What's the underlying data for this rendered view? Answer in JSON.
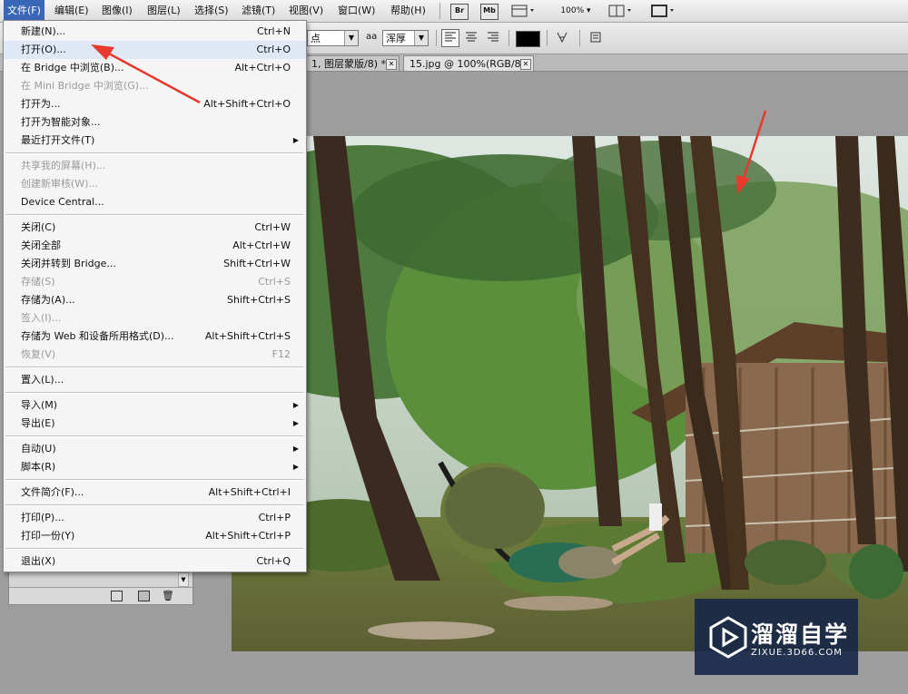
{
  "menubar": {
    "items": [
      "文件(F)",
      "编辑(E)",
      "图像(I)",
      "图层(L)",
      "选择(S)",
      "滤镜(T)",
      "视图(V)",
      "窗口(W)",
      "帮助(H)"
    ],
    "toolbar": {
      "br": "Br",
      "mb": "Mb",
      "zoom": "100%"
    }
  },
  "options": {
    "font_size": "点",
    "aa_icon": "aa",
    "aa_mode": "浑厚"
  },
  "tabs": [
    {
      "label": "1, 图层蒙版/8) *"
    },
    {
      "label": "15.jpg @ 100%(RGB/8)"
    }
  ],
  "file_menu": {
    "items": [
      {
        "label": "新建(N)...",
        "shortcut": "Ctrl+N"
      },
      {
        "label": "打开(O)...",
        "shortcut": "Ctrl+O",
        "highlight": true
      },
      {
        "label": "在 Bridge 中浏览(B)...",
        "shortcut": "Alt+Ctrl+O"
      },
      {
        "label": "在 Mini Bridge 中浏览(G)...",
        "shortcut": "",
        "disabled": true
      },
      {
        "label": "打开为...",
        "shortcut": "Alt+Shift+Ctrl+O"
      },
      {
        "label": "打开为智能对象...",
        "shortcut": ""
      },
      {
        "label": "最近打开文件(T)",
        "shortcut": "",
        "submenu": true
      },
      {
        "sep": true
      },
      {
        "label": "共享我的屏幕(H)...",
        "shortcut": "",
        "disabled": true
      },
      {
        "label": "创建新审核(W)...",
        "shortcut": "",
        "disabled": true
      },
      {
        "label": "Device Central...",
        "shortcut": ""
      },
      {
        "sep": true
      },
      {
        "label": "关闭(C)",
        "shortcut": "Ctrl+W"
      },
      {
        "label": "关闭全部",
        "shortcut": "Alt+Ctrl+W"
      },
      {
        "label": "关闭并转到 Bridge...",
        "shortcut": "Shift+Ctrl+W"
      },
      {
        "label": "存储(S)",
        "shortcut": "Ctrl+S",
        "disabled": true
      },
      {
        "label": "存储为(A)...",
        "shortcut": "Shift+Ctrl+S"
      },
      {
        "label": "签入(I)...",
        "shortcut": "",
        "disabled": true
      },
      {
        "label": "存储为 Web 和设备所用格式(D)...",
        "shortcut": "Alt+Shift+Ctrl+S"
      },
      {
        "label": "恢复(V)",
        "shortcut": "F12",
        "disabled": true
      },
      {
        "sep": true
      },
      {
        "label": "置入(L)...",
        "shortcut": ""
      },
      {
        "sep": true
      },
      {
        "label": "导入(M)",
        "shortcut": "",
        "submenu": true
      },
      {
        "label": "导出(E)",
        "shortcut": "",
        "submenu": true
      },
      {
        "sep": true
      },
      {
        "label": "自动(U)",
        "shortcut": "",
        "submenu": true
      },
      {
        "label": "脚本(R)",
        "shortcut": "",
        "submenu": true
      },
      {
        "sep": true
      },
      {
        "label": "文件简介(F)...",
        "shortcut": "Alt+Shift+Ctrl+I"
      },
      {
        "sep": true
      },
      {
        "label": "打印(P)...",
        "shortcut": "Ctrl+P"
      },
      {
        "label": "打印一份(Y)",
        "shortcut": "Alt+Shift+Ctrl+P"
      },
      {
        "sep": true
      },
      {
        "label": "退出(X)",
        "shortcut": "Ctrl+Q"
      }
    ]
  },
  "watermark": {
    "title": "溜溜自学",
    "url": "ZIXUE.3D66.COM"
  },
  "colors": {
    "menu_active": "#3a67b5",
    "annotation_arrow": "#e8392f",
    "watermark_bg": "#142448"
  }
}
